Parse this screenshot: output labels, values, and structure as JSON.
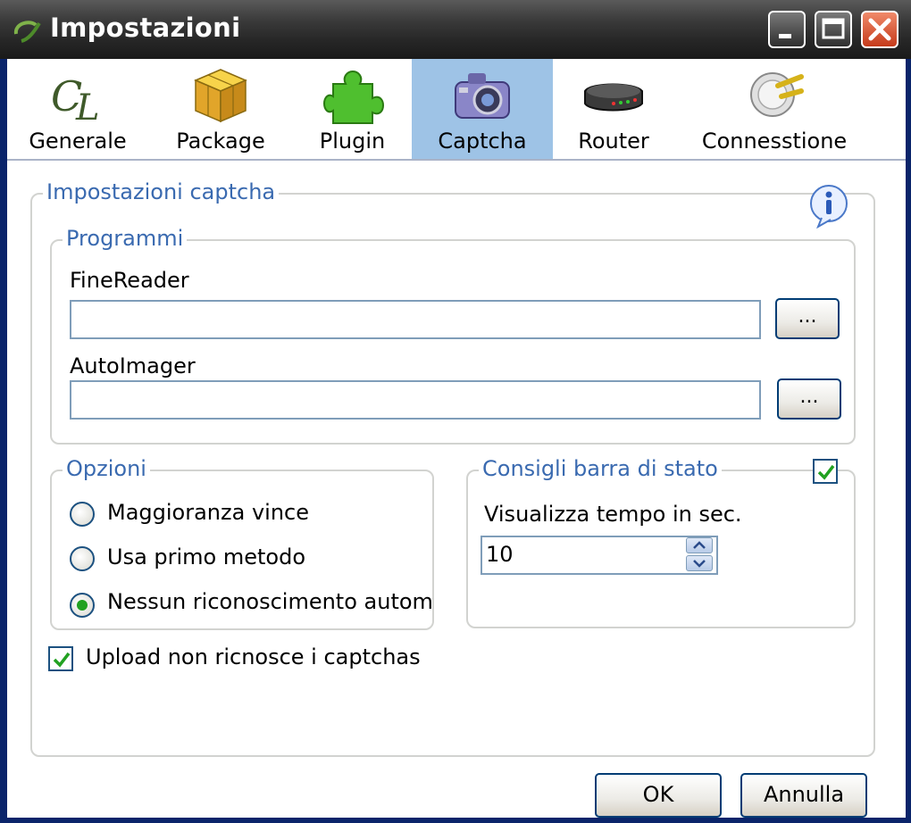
{
  "window": {
    "title": "Impostazioni"
  },
  "toolbar": {
    "items": [
      {
        "label": "Generale",
        "icon": "cl-logo-icon"
      },
      {
        "label": "Package",
        "icon": "package-icon"
      },
      {
        "label": "Plugin",
        "icon": "puzzle-icon"
      },
      {
        "label": "Captcha",
        "icon": "camera-icon",
        "selected": true
      },
      {
        "label": "Router",
        "icon": "router-icon"
      },
      {
        "label": "Connesstione",
        "icon": "plug-icon"
      }
    ]
  },
  "captcha": {
    "group_title": "Impostazioni captcha",
    "programs": {
      "title": "Programmi",
      "finereader_label": "FineReader",
      "finereader_value": "",
      "autoimager_label": "AutoImager",
      "autoimager_value": "",
      "browse_label": "..."
    },
    "options": {
      "title": "Opzioni",
      "items": [
        {
          "label": "Maggioranza vince",
          "checked": false
        },
        {
          "label": "Usa primo metodo",
          "checked": false
        },
        {
          "label": "Nessun riconoscimento automatico",
          "checked": true
        }
      ]
    },
    "statusbar": {
      "title": "Consigli barra di stato",
      "enabled": true,
      "time_label": "Visualizza tempo in sec.",
      "time_value": "10"
    },
    "upload_label": "Upload non ricnosce i captchas",
    "upload_checked": true
  },
  "buttons": {
    "ok": "OK",
    "cancel": "Annulla"
  },
  "colors": {
    "accent": "#3a6ab0",
    "selected_tab": "#9ec3e6",
    "check_green": "#21a121"
  }
}
